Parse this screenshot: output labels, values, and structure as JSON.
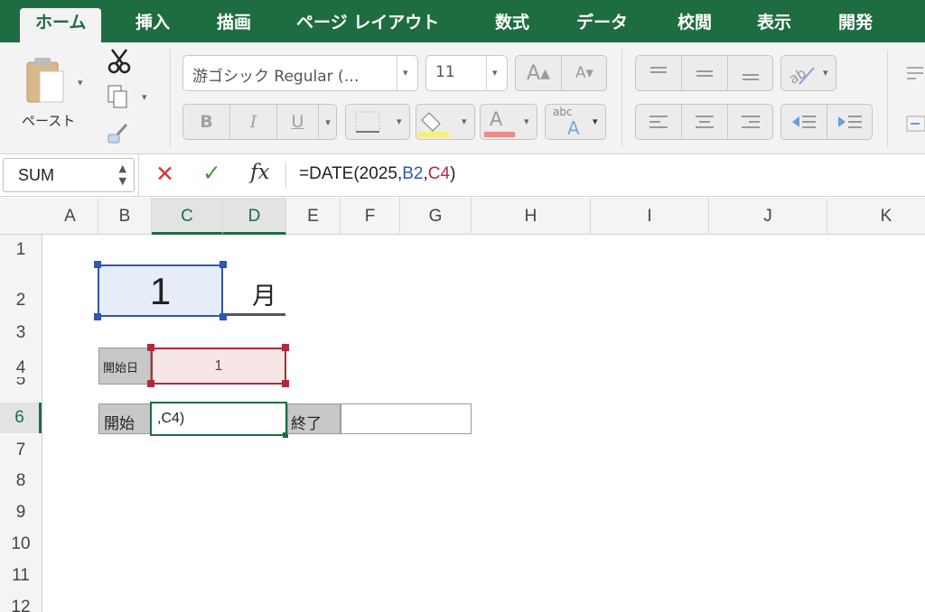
{
  "tabs": [
    "ホーム",
    "挿入",
    "描画",
    "ページ レイアウト",
    "数式",
    "データ",
    "校閲",
    "表示",
    "開発"
  ],
  "ribbon": {
    "paste_label": "ペースト",
    "font_name": "游ゴシック Regular (…",
    "font_size": "11",
    "bold": "B",
    "italic": "I",
    "underline": "U",
    "font_color_glyph": "A",
    "abc_label": "abc"
  },
  "formula_bar": {
    "name_box": "SUM",
    "cancel": "✕",
    "enter": "✓",
    "fx": "fx",
    "formula_prefix": "=DATE(2025,",
    "ref1": "B2",
    "comma": ",",
    "ref2": "C4",
    "formula_suffix": ")"
  },
  "columns": [
    "A",
    "B",
    "C",
    "D",
    "E",
    "F",
    "G",
    "H",
    "I",
    "J",
    "K"
  ],
  "rows": [
    "1",
    "2",
    "3",
    "4",
    "5",
    "6",
    "7",
    "8",
    "9",
    "10",
    "11",
    "12"
  ],
  "cells": {
    "B2": "1",
    "D2": "月",
    "B4": "開始日",
    "C4": "1",
    "B6": "開始",
    "C6": ",C4)",
    "E6": "終了",
    "F6": ""
  },
  "colors": {
    "ribbon_green": "#1e6c41",
    "ref_blue": "#2f56b3",
    "ref_red": "#b22a3a"
  }
}
